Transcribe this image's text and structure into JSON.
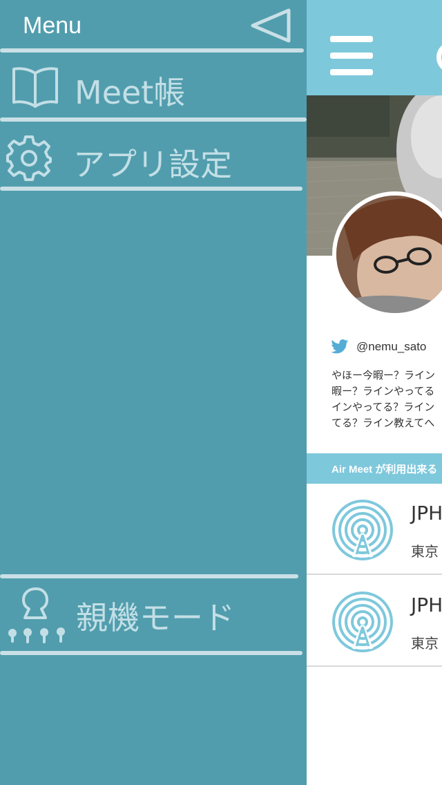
{
  "menu": {
    "title": "Menu",
    "items": [
      {
        "label": "Meet帳",
        "icon": "book-icon"
      },
      {
        "label": "アプリ設定",
        "icon": "gear-icon"
      },
      {
        "label": "親機モード",
        "icon": "host-mode-icon"
      }
    ],
    "back_icon": "back-triangle-icon"
  },
  "main": {
    "nav_icon": "hamburger-icon",
    "profile": {
      "twitter_handle": "@nemu_sato",
      "bio_lines": [
        "やほー今暇ー？ライン",
        "暇ー？ラインやってる",
        "インやってる？ライン",
        "てる？ライン教えてへ"
      ]
    },
    "section_title": "Air Meet が利用出来る",
    "spots": [
      {
        "name": "JPH",
        "city": "東京",
        "icon": "beacon-icon"
      },
      {
        "name": "JPH",
        "city": "東京",
        "icon": "beacon-icon"
      }
    ]
  },
  "colors": {
    "menu_bg": "#519dad",
    "accent": "#7ec8dc",
    "menu_text": "#c3dfe6"
  }
}
